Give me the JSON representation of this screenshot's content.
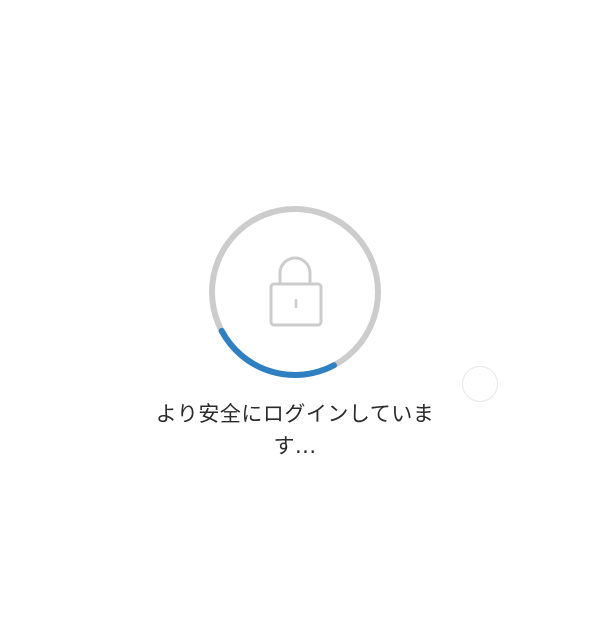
{
  "loading": {
    "message_line1": "より安全にログインしていま",
    "message_line2": "す...",
    "progress_fraction": 0.25,
    "colors": {
      "track": "#cccccc",
      "progress": "#2f80c2",
      "lock": "#cccccc"
    },
    "icon": "lock-icon"
  }
}
